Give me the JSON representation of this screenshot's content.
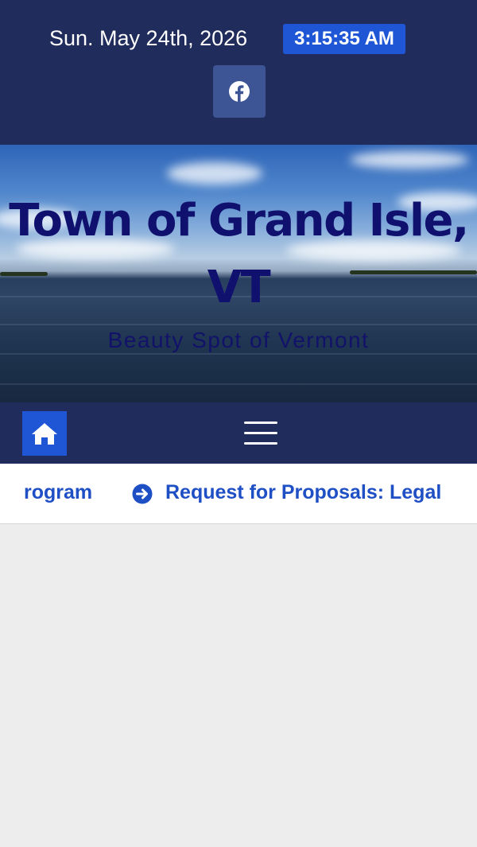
{
  "header": {
    "date": "Sun. May 24th, 2026",
    "time": "3:15:35 AM",
    "social_icon": "facebook-icon"
  },
  "hero": {
    "title": "Town of Grand Isle, VT",
    "tagline": "Beauty Spot of Vermont"
  },
  "nav": {
    "home_icon": "home-icon",
    "menu_icon": "hamburger-menu-icon"
  },
  "ticker": {
    "items": [
      {
        "label": "rogram"
      },
      {
        "label": "Request for Proposals: Legal",
        "icon": "arrow-circle-right-icon"
      }
    ]
  },
  "colors": {
    "header_bg": "#202d5c",
    "accent": "#1e56d6",
    "link": "#1f4fc4",
    "title": "#10106e"
  }
}
